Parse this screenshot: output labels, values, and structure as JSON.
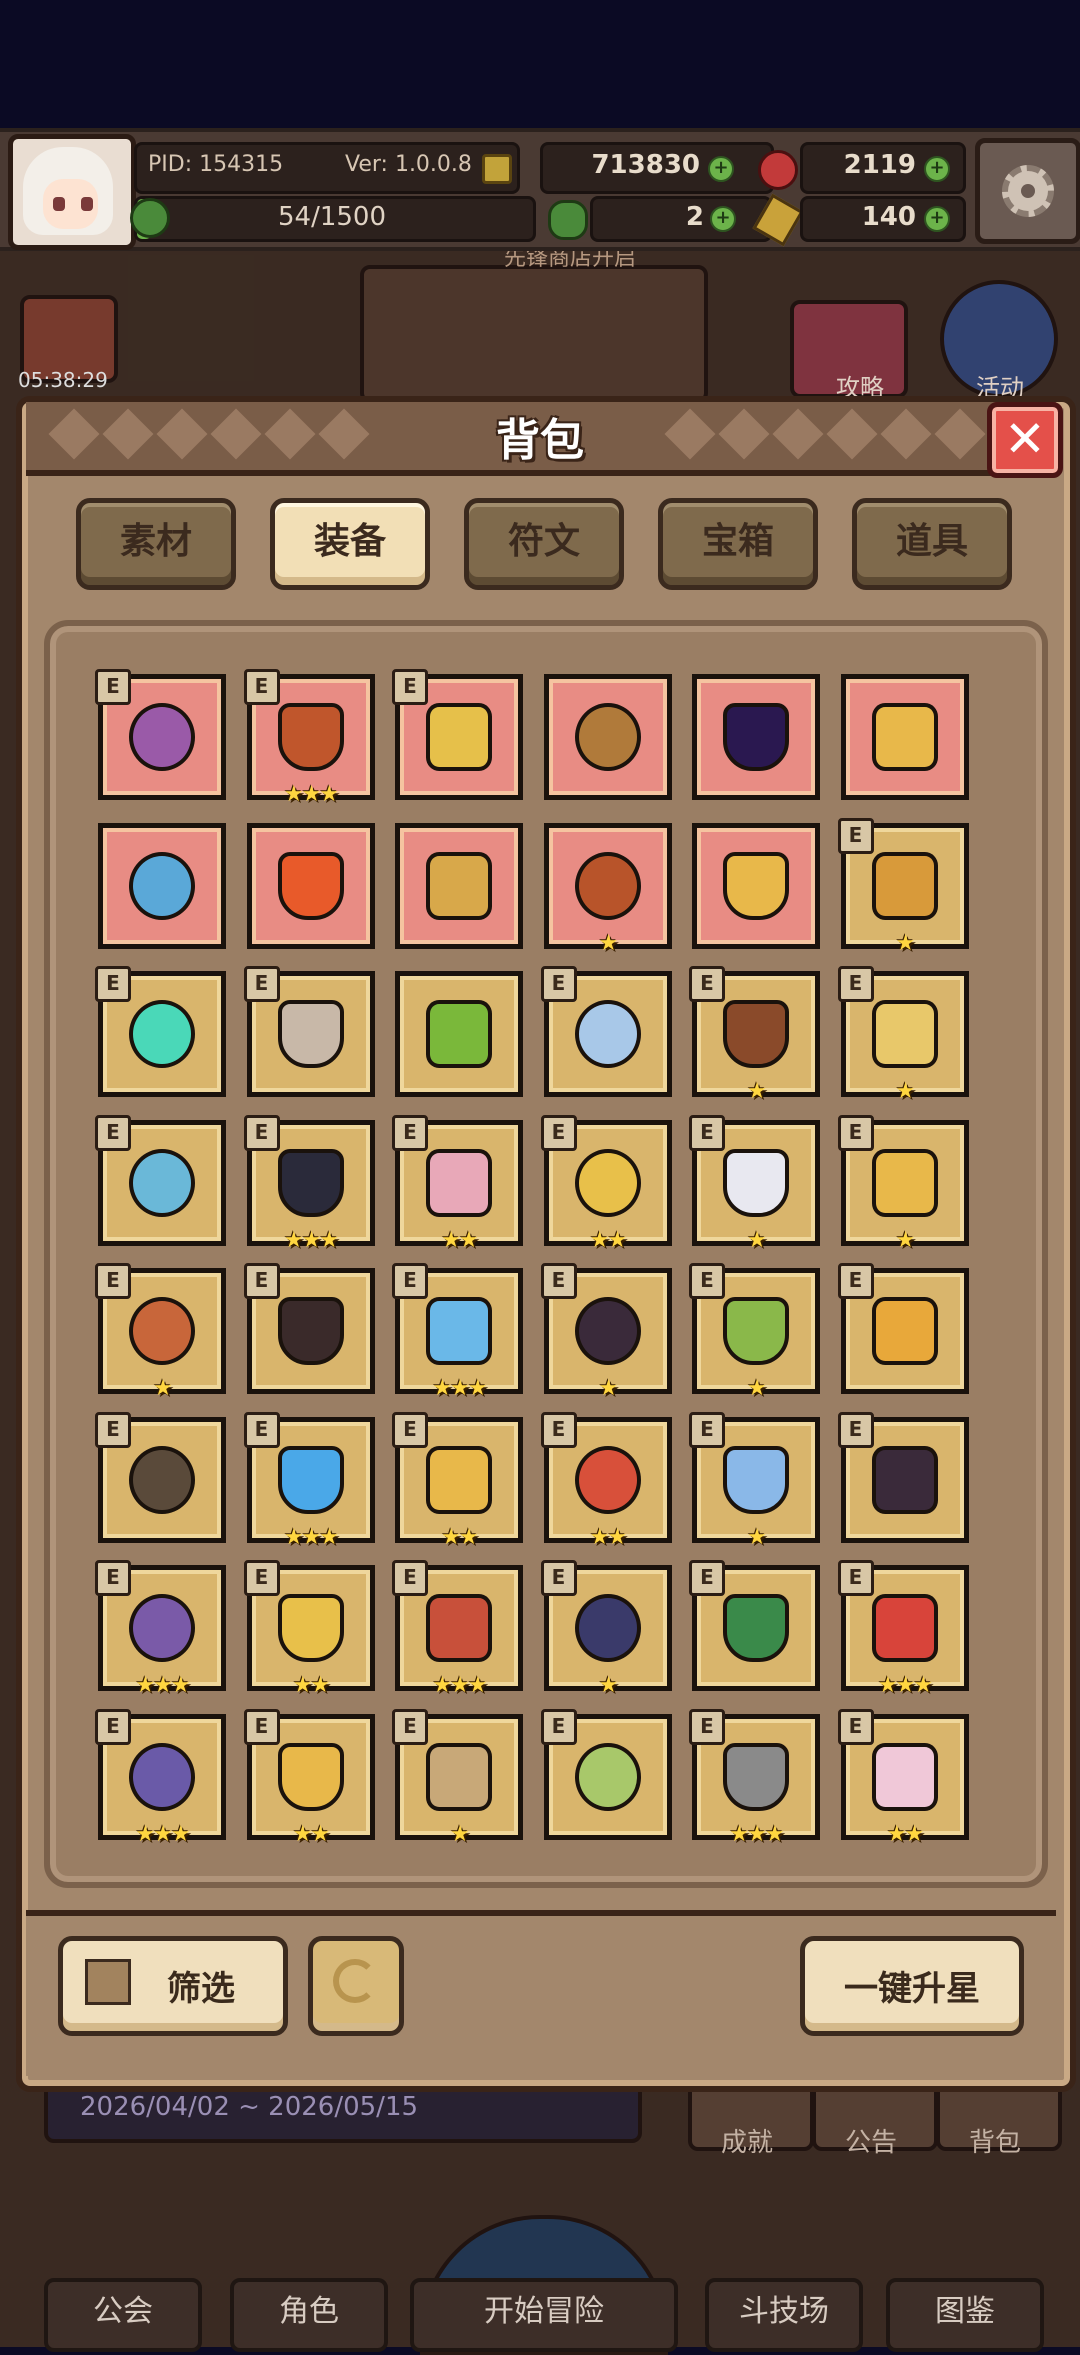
{
  "hud": {
    "pid": "PID: 154315",
    "version": "Ver: 1.0.0.8",
    "exp": "54/1500",
    "gold": "713830",
    "gems": "2119",
    "clover": "2",
    "keys": "140"
  },
  "background": {
    "timer": "05:38:29",
    "shop_banner": "先锋商店开启",
    "date_range": "2026/04/02 ~ 2026/05/15",
    "side_labels": [
      "攻略",
      "活动"
    ],
    "quick_labels": [
      "成就",
      "公告",
      "背包"
    ],
    "nav": [
      "公会",
      "角色",
      "开始冒险",
      "斗技场",
      "图鉴"
    ]
  },
  "dialog": {
    "title": "背包",
    "close_label": "✕",
    "tabs": [
      "素材",
      "装备",
      "符文",
      "宝箱",
      "道具"
    ],
    "active_tab": 1,
    "filter_label": "筛选",
    "upgrade_label": "一键升星",
    "items": [
      {
        "name": "pendant-charm",
        "bg": "red",
        "e": true,
        "stars": 0
      },
      {
        "name": "pot-helmet",
        "bg": "red",
        "e": true,
        "stars": 3
      },
      {
        "name": "gold-ring",
        "bg": "red",
        "e": true,
        "stars": 0
      },
      {
        "name": "wooden-staff",
        "bg": "red",
        "e": false,
        "stars": 0
      },
      {
        "name": "dark-orb",
        "bg": "red",
        "e": false,
        "stars": 0
      },
      {
        "name": "straw-hat",
        "bg": "red",
        "e": false,
        "stars": 0
      },
      {
        "name": "steel-helmet",
        "bg": "red",
        "e": false,
        "stars": 0
      },
      {
        "name": "fire-ring",
        "bg": "red",
        "e": false,
        "stars": 0
      },
      {
        "name": "horned-crown",
        "bg": "red",
        "e": false,
        "stars": 0
      },
      {
        "name": "red-cloak",
        "bg": "red",
        "e": false,
        "stars": 1
      },
      {
        "name": "heart-necklace",
        "bg": "red",
        "e": false,
        "stars": 0
      },
      {
        "name": "golden-scepter",
        "bg": "gold",
        "e": true,
        "stars": 1
      },
      {
        "name": "jade-bow",
        "bg": "gold",
        "e": true,
        "stars": 0
      },
      {
        "name": "battle-axe",
        "bg": "gold",
        "e": true,
        "stars": 0
      },
      {
        "name": "emerald-staff",
        "bg": "gold",
        "e": false,
        "stars": 0
      },
      {
        "name": "silver-sword",
        "bg": "gold",
        "e": true,
        "stars": 0
      },
      {
        "name": "horned-shield",
        "bg": "gold",
        "e": true,
        "stars": 1
      },
      {
        "name": "crystal-shield",
        "bg": "gold",
        "e": true,
        "stars": 1
      },
      {
        "name": "ice-shield",
        "bg": "gold",
        "e": true,
        "stars": 0
      },
      {
        "name": "winged-helm",
        "bg": "gold",
        "e": true,
        "stars": 3
      },
      {
        "name": "pink-beast-helm",
        "bg": "gold",
        "e": true,
        "stars": 2
      },
      {
        "name": "gold-circlet",
        "bg": "gold",
        "e": true,
        "stars": 2
      },
      {
        "name": "white-hood",
        "bg": "gold",
        "e": true,
        "stars": 1
      },
      {
        "name": "royal-helm",
        "bg": "gold",
        "e": true,
        "stars": 1
      },
      {
        "name": "jewel-bracer",
        "bg": "gold",
        "e": true,
        "stars": 1
      },
      {
        "name": "demon-armor",
        "bg": "gold",
        "e": true,
        "stars": 0
      },
      {
        "name": "frost-armor",
        "bg": "gold",
        "e": true,
        "stars": 3
      },
      {
        "name": "dark-plate",
        "bg": "gold",
        "e": true,
        "stars": 1
      },
      {
        "name": "leaf-armor",
        "bg": "gold",
        "e": true,
        "stars": 1
      },
      {
        "name": "gold-plate",
        "bg": "gold",
        "e": true,
        "stars": 0
      },
      {
        "name": "dragon-gauntlet",
        "bg": "gold",
        "e": true,
        "stars": 0
      },
      {
        "name": "ice-gauntlet",
        "bg": "gold",
        "e": true,
        "stars": 3
      },
      {
        "name": "gold-bracer",
        "bg": "gold",
        "e": true,
        "stars": 2
      },
      {
        "name": "flame-glove",
        "bg": "gold",
        "e": true,
        "stars": 2
      },
      {
        "name": "sapphire-gauntlet",
        "bg": "gold",
        "e": true,
        "stars": 1
      },
      {
        "name": "shadow-gauntlet",
        "bg": "gold",
        "e": true,
        "stars": 0
      },
      {
        "name": "amethyst-amulet",
        "bg": "gold",
        "e": true,
        "stars": 3
      },
      {
        "name": "gold-necklace",
        "bg": "gold",
        "e": true,
        "stars": 2
      },
      {
        "name": "ruby-necklace",
        "bg": "gold",
        "e": true,
        "stars": 3
      },
      {
        "name": "gem-belt",
        "bg": "gold",
        "e": true,
        "stars": 1
      },
      {
        "name": "emerald-band",
        "bg": "gold",
        "e": true,
        "stars": 0
      },
      {
        "name": "hero-boots",
        "bg": "gold",
        "e": true,
        "stars": 3
      },
      {
        "name": "dark-boots",
        "bg": "gold",
        "e": true,
        "stars": 3
      },
      {
        "name": "winged-boots",
        "bg": "gold",
        "e": true,
        "stars": 2
      },
      {
        "name": "leather-boots",
        "bg": "gold",
        "e": true,
        "stars": 1
      },
      {
        "name": "moss-boots",
        "bg": "gold",
        "e": true,
        "stars": 0
      },
      {
        "name": "stone-boots",
        "bg": "gold",
        "e": true,
        "stars": 3
      },
      {
        "name": "angel-boots",
        "bg": "gold",
        "e": true,
        "stars": 2
      }
    ]
  }
}
